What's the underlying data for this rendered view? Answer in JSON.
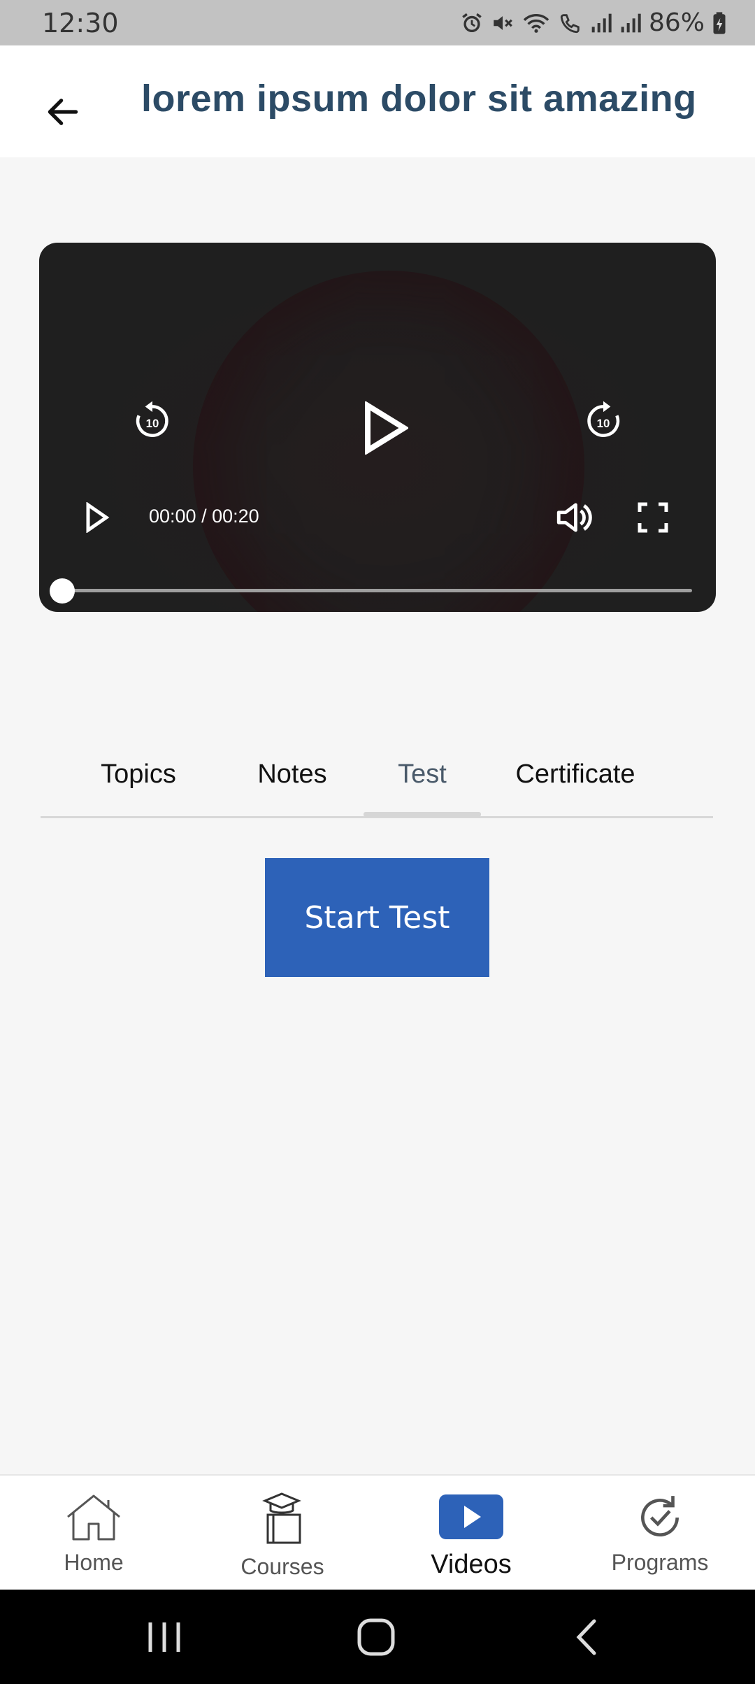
{
  "status_bar": {
    "time": "12:30",
    "battery": "86%",
    "icons": [
      "alarm-icon",
      "mute-icon",
      "wifi-icon",
      "wifi-calling-icon",
      "signal-icon",
      "signal-icon",
      "battery-charging-icon"
    ]
  },
  "app_bar": {
    "title": "lorem ipsum dolor sit amazing",
    "back_icon": "arrow-left-icon"
  },
  "player": {
    "time": "00:00 / 00:20",
    "progress": 0,
    "controls": [
      "replay-10-icon",
      "play-icon",
      "forward-10-icon",
      "volume-icon",
      "fullscreen-icon"
    ],
    "skip_seconds": "10"
  },
  "tabs": {
    "items": [
      {
        "label": "Topics"
      },
      {
        "label": "Notes"
      },
      {
        "label": "Test"
      },
      {
        "label": "Certificate"
      }
    ],
    "selected": "Test"
  },
  "main": {
    "start_button": "Start Test"
  },
  "bottom_nav": {
    "items": [
      {
        "label": "Home",
        "icon": "home-icon"
      },
      {
        "label": "Courses",
        "icon": "courses-icon"
      },
      {
        "label": "Videos",
        "icon": "video-icon"
      },
      {
        "label": "Programs",
        "icon": "programs-icon"
      }
    ],
    "active": "Videos"
  },
  "colors": {
    "title": "#2c4b66",
    "accent": "#2d62b8",
    "background": "#f6f6f6"
  }
}
